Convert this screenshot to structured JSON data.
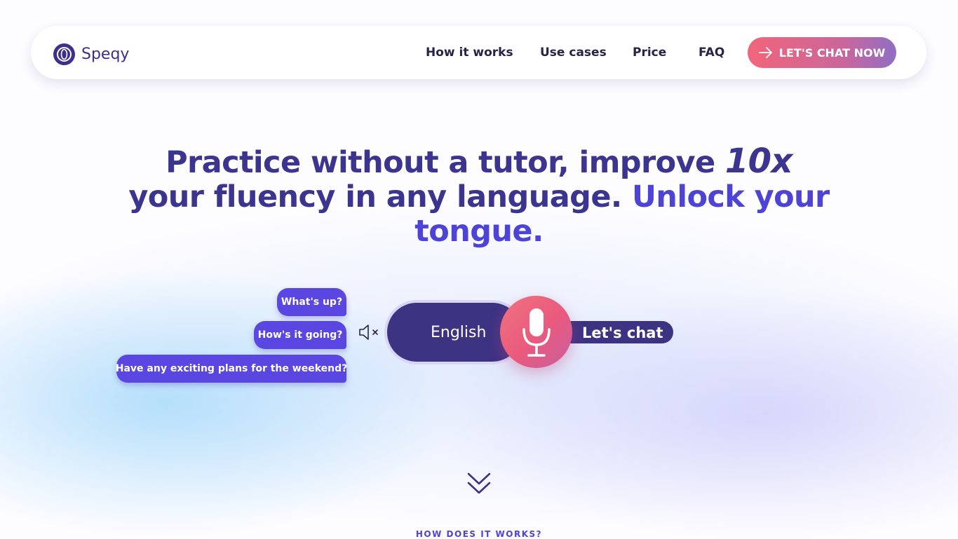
{
  "brand": {
    "name": "Speqy"
  },
  "nav": {
    "items": [
      {
        "label": "How it works"
      },
      {
        "label": "Use cases"
      },
      {
        "label": "Price"
      },
      {
        "label": "FAQ"
      }
    ],
    "cta_label": "LET'S CHAT NOW",
    "cta_icon": "arrow-right-icon"
  },
  "hero": {
    "title_part1": "Practice without a tutor, improve ",
    "title_emphasis": "10x",
    "title_part2": " your fluency in any language.",
    "title_part3": " Unlock your tongue."
  },
  "chat": {
    "bubbles": [
      {
        "text": "What's up?"
      },
      {
        "text": "How's it going?"
      },
      {
        "text": "Have any exciting plans for the weekend?"
      }
    ],
    "mute_icon": "speaker-muted-icon",
    "language": "English",
    "mic_icon": "microphone-icon",
    "action_label": "Let's chat"
  },
  "scroll_icon": "double-chevron-down-icon",
  "section": {
    "label": "HOW DOES IT WORKS?"
  },
  "colors": {
    "brand": "#3d2f8a",
    "accent": "#4d43d6",
    "bubble": "#5a46e0",
    "cta_start": "#f2657a",
    "cta_end": "#8f6fc4"
  }
}
